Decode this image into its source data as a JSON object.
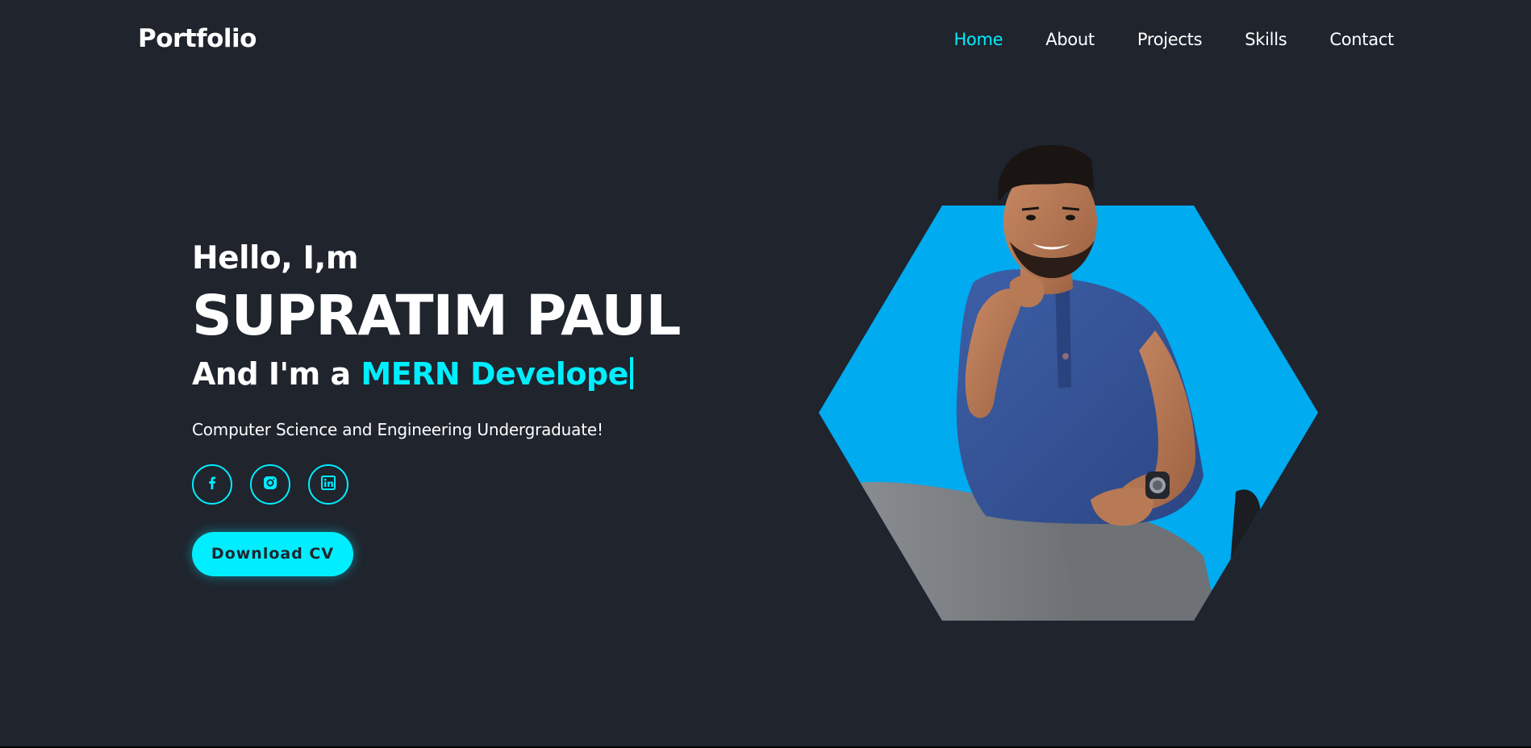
{
  "header": {
    "logo": "Portfolio",
    "nav": [
      {
        "label": "Home",
        "active": true
      },
      {
        "label": "About",
        "active": false
      },
      {
        "label": "Projects",
        "active": false
      },
      {
        "label": "Skills",
        "active": false
      },
      {
        "label": "Contact",
        "active": false
      }
    ]
  },
  "hero": {
    "greeting": "Hello, I,m",
    "name": "SUPRATIM PAUL",
    "role_prefix": "And I'm a",
    "role": "MERN Develope",
    "tagline": "Computer Science and Engineering Undergraduate!",
    "socials": [
      {
        "icon": "facebook-icon"
      },
      {
        "icon": "instagram-icon"
      },
      {
        "icon": "linkedin-icon"
      }
    ],
    "cv_button": "Download CV",
    "image_alt": "portrait-photo"
  },
  "colors": {
    "background": "#1f242d",
    "accent": "#00eeff",
    "hexagon": "#00abf0",
    "text": "#ffffff"
  }
}
